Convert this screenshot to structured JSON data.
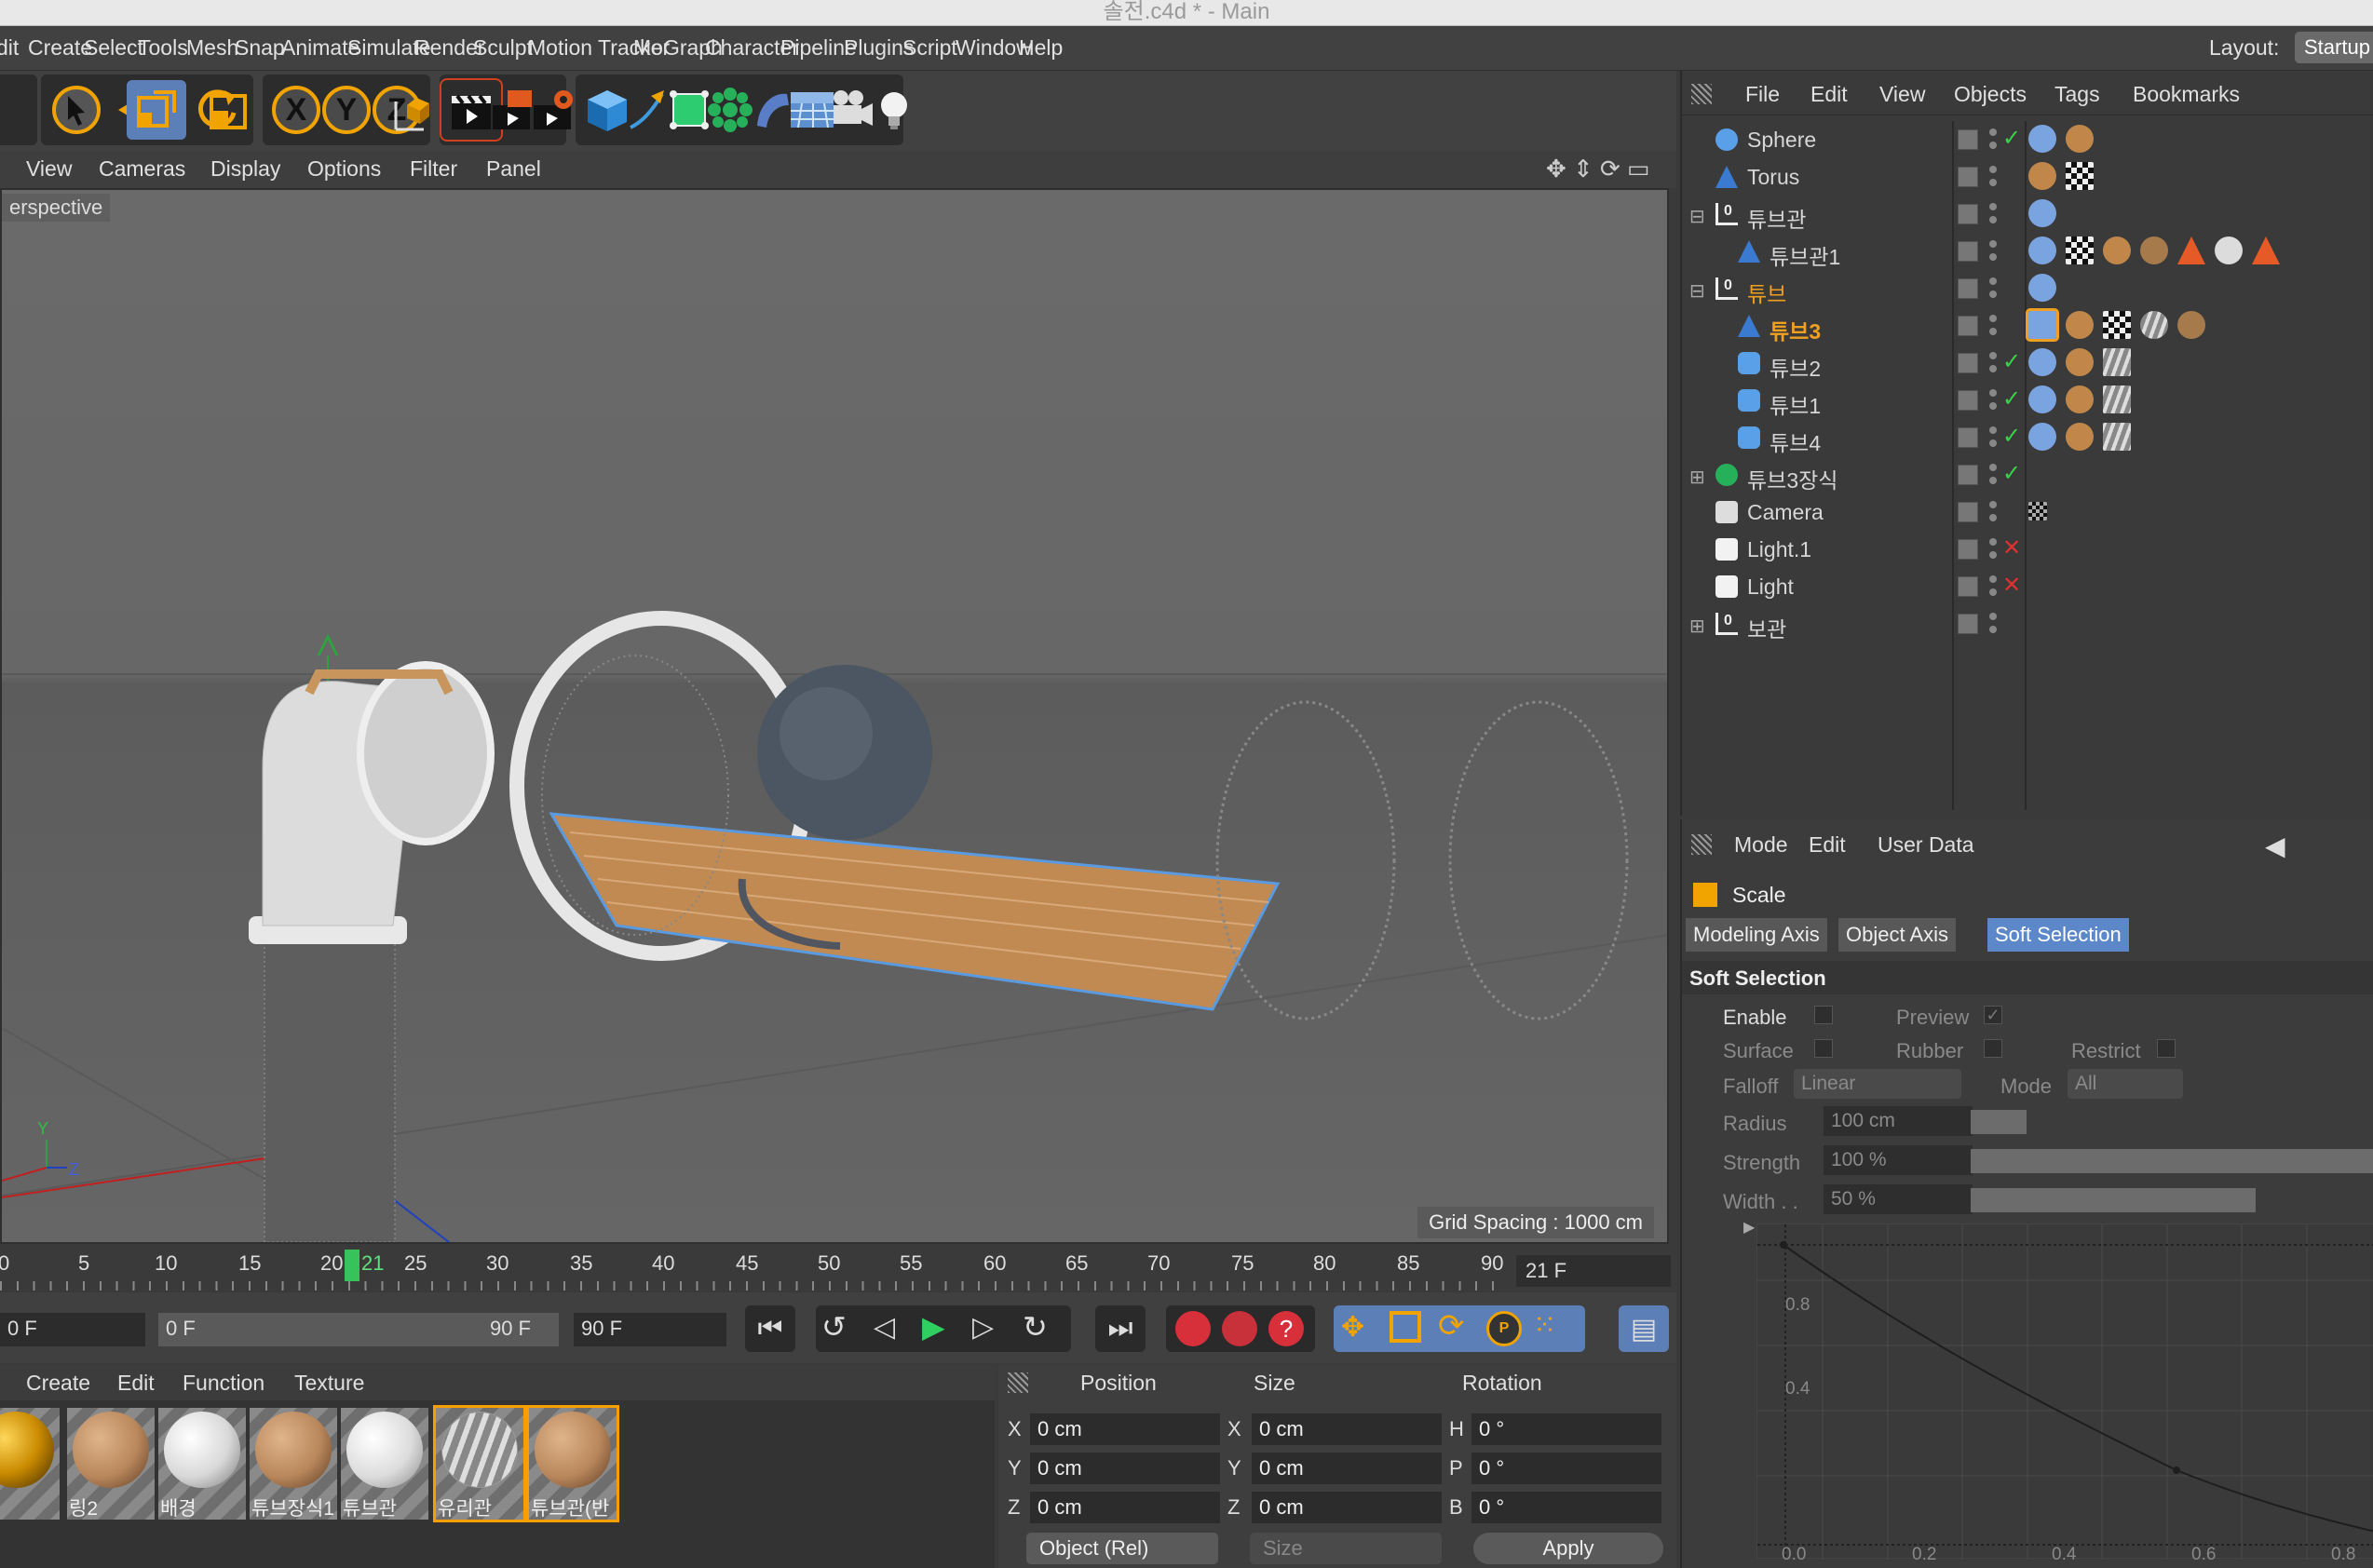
{
  "window": {
    "title": "솔전.c4d * - Main"
  },
  "menu": {
    "items": [
      "dit",
      "Create",
      "Select",
      "Tools",
      "Mesh",
      "Snap",
      "Animate",
      "Simulate",
      "Render",
      "Sculpt",
      "Motion Tracker",
      "MoGraph",
      "Character",
      "Pipeline",
      "Plugins",
      "Script",
      "Window",
      "Help"
    ],
    "layout_label": "Layout:",
    "layout_value": "Startup"
  },
  "toolbar": {
    "axis_x": "X",
    "axis_y": "Y",
    "axis_z": "Z"
  },
  "viewport": {
    "menu": [
      "View",
      "Cameras",
      "Display",
      "Options",
      "Filter",
      "Panel"
    ],
    "camera": "erspective",
    "grid_spacing": "Grid Spacing : 1000 cm",
    "axis_labels": {
      "y": "Y",
      "z": "Z"
    }
  },
  "timeline": {
    "ticks": [
      "0",
      "5",
      "10",
      "15",
      "20",
      "21",
      "25",
      "30",
      "35",
      "40",
      "45",
      "50",
      "55",
      "60",
      "65",
      "70",
      "75",
      "80",
      "85",
      "90"
    ],
    "current_frame": "21 F",
    "start_field": "0 F",
    "range_start": "0 F",
    "range_end": "90 F",
    "end_field": "90 F"
  },
  "materials": {
    "menu": [
      "Create",
      "Edit",
      "Function",
      "Texture"
    ],
    "items": [
      {
        "name": "",
        "color": "#c98a00"
      },
      {
        "name": "링2",
        "color": "#b9875c"
      },
      {
        "name": "배경",
        "color": "#d8d8d8"
      },
      {
        "name": "튜브장식1",
        "color": "#b9875c"
      },
      {
        "name": "튜브관",
        "color": "#dcdcdc"
      },
      {
        "name": "유리관",
        "color": "#a9a9a9"
      },
      {
        "name": "튜브관(반",
        "color": "#b9875c"
      }
    ]
  },
  "coordinates": {
    "headers": [
      "Position",
      "Size",
      "Rotation"
    ],
    "position": [
      {
        "axis": "X",
        "value": "0 cm"
      },
      {
        "axis": "Y",
        "value": "0 cm"
      },
      {
        "axis": "Z",
        "value": "0 cm"
      }
    ],
    "size": [
      {
        "axis": "X",
        "value": "0 cm"
      },
      {
        "axis": "Y",
        "value": "0 cm"
      },
      {
        "axis": "Z",
        "value": "0 cm"
      }
    ],
    "rotation": [
      {
        "axis": "H",
        "value": "0 °"
      },
      {
        "axis": "P",
        "value": "0 °"
      },
      {
        "axis": "B",
        "value": "0 °"
      }
    ],
    "mode": "Object (Rel)",
    "size_mode": "Size",
    "apply": "Apply"
  },
  "objects": {
    "menu": [
      "File",
      "Edit",
      "View",
      "Objects",
      "Tags",
      "Bookmarks"
    ],
    "rows": [
      {
        "name": "Sphere",
        "status": "✓"
      },
      {
        "name": "Torus",
        "status": ""
      },
      {
        "name": "튜브관",
        "status": ""
      },
      {
        "name": "튜브관1",
        "status": ""
      },
      {
        "name": "튜브",
        "status": ""
      },
      {
        "name": "튜브3",
        "status": ""
      },
      {
        "name": "튜브2",
        "status": "✓"
      },
      {
        "name": "튜브1",
        "status": "✓"
      },
      {
        "name": "튜브4",
        "status": "✓"
      },
      {
        "name": "튜브3장식",
        "status": "✓"
      },
      {
        "name": "Camera",
        "status": ""
      },
      {
        "name": "Light.1",
        "status": "✕"
      },
      {
        "name": "Light",
        "status": "✕"
      },
      {
        "name": "보관",
        "status": ""
      }
    ]
  },
  "attributes": {
    "menu": [
      "Mode",
      "Edit",
      "User Data"
    ],
    "tool": "Scale",
    "tabs": [
      "Modeling Axis",
      "Object Axis",
      "Soft Selection"
    ],
    "section": "Soft Selection",
    "enable": "Enable",
    "preview": "Preview",
    "surface": "Surface",
    "rubber": "Rubber",
    "restrict": "Restrict",
    "falloff_label": "Falloff",
    "falloff_value": "Linear",
    "mode_label": "Mode",
    "mode_value": "All",
    "radius_label": "Radius",
    "radius_value": "100 cm",
    "strength_label": "Strength",
    "strength_value": "100 %",
    "width_label": "Width . .",
    "width_value": "50 %",
    "graph_y": [
      "0.8",
      "0.4"
    ],
    "graph_x": [
      "0.0",
      "0.2",
      "0.4",
      "0.6",
      "0.8"
    ]
  },
  "colors": {
    "accent": "#5c87c9",
    "highlight": "#f1a300",
    "selected_text": "#f0a020"
  }
}
